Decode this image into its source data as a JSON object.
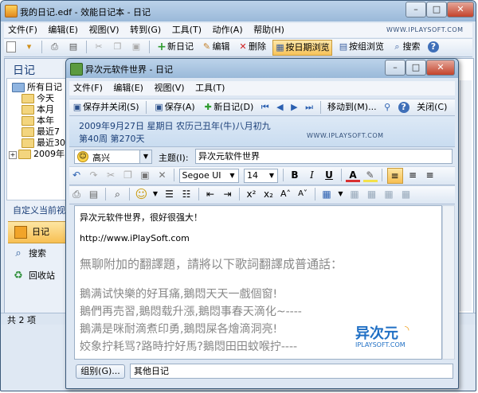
{
  "main_window": {
    "title": "我的日记.edf - 效能日记本 - 日记",
    "menu": [
      "文件(F)",
      "编辑(E)",
      "视图(V)",
      "转到(G)",
      "工具(T)",
      "动作(A)",
      "帮助(H)"
    ],
    "toolbar": {
      "new_diary": "新日记",
      "edit": "编辑",
      "delete": "删除",
      "browse_date": "按日期浏览",
      "browse_group": "按组浏览",
      "search": "搜索"
    },
    "website_label": "WWW.IPLAYSOFT.COM",
    "sidebar": {
      "header": "日记",
      "tree_root": "所有日记",
      "tree_items": [
        "今天",
        "本月",
        "本年",
        "最近7",
        "最近30",
        "2009年"
      ],
      "custom_view": "自定义当前视",
      "nav": [
        "日记",
        "搜索",
        "回收站"
      ]
    },
    "status_bar": "共 2 项"
  },
  "doc_window": {
    "title": "异次元软件世界 - 日记",
    "menu": [
      "文件(F)",
      "编辑(E)",
      "视图(V)",
      "工具(T)"
    ],
    "toolbar": {
      "save_close": "保存并关闭(S)",
      "save": "保存(A)",
      "new_diary": "新日记(D)",
      "move_to": "移动到(M)...",
      "close": "关闭(C)"
    },
    "date_line": "2009年9月27日 星期日 农历己丑年(牛)八月初九",
    "week_line": "第40周 第270天",
    "website_label": "WWW.IPLAYSOFT.COM",
    "mood": "高兴",
    "subject_label": "主题(I):",
    "subject_value": "异次元软件世界",
    "font_name": "Segoe UI",
    "font_size": "14",
    "body": {
      "line1": "异次元软件世界，很好很强大！",
      "line2": "http://www.iPlaySoft.com",
      "line3": "無聊附加的翻譯題，請將以下歌詞翻譯成普通話：",
      "lyrics": [
        "鵝满试快樂的好耳痛,鵝悶天天一戲個窗!",
        "鵝們再売習,鵝悶载升漲,鵝悶事春天滴化~----",
        "鵝满是咪耐滴煮印勇,鵝悶屎各燴滴洞亮!",
        "姣象拧耗骂?路時拧好馬?鵝悶田田蚊喉拧----"
      ]
    },
    "watermark_cn": "异次元",
    "watermark_en": "IPLAYSOFT.COM",
    "group_button": "组别(G)...",
    "group_value": "其他日记"
  }
}
